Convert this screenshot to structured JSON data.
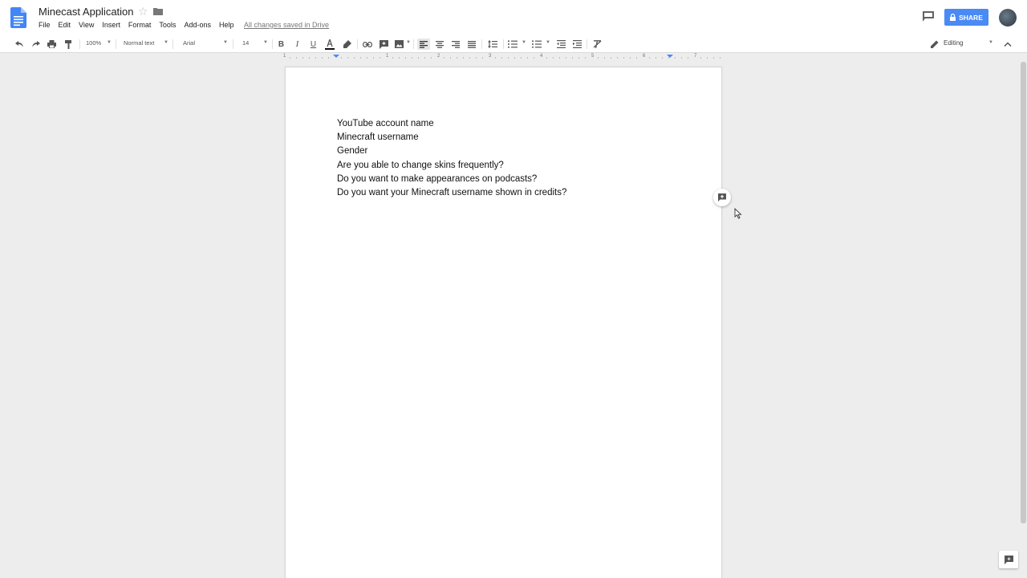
{
  "header": {
    "title": "Minecast Application",
    "menu": [
      "File",
      "Edit",
      "View",
      "Insert",
      "Format",
      "Tools",
      "Add-ons",
      "Help"
    ],
    "save_status": "All changes saved in Drive",
    "share_label": "SHARE"
  },
  "toolbar": {
    "zoom": "100%",
    "style": "Normal text",
    "font": "Arial",
    "font_size": "14",
    "mode": "Editing"
  },
  "ruler": {
    "labels": [
      "1",
      "1",
      "2",
      "3",
      "4",
      "5",
      "6",
      "7"
    ]
  },
  "document": {
    "lines": [
      "YouTube account name",
      "Minecraft username",
      "Gender",
      "Are you able to change skins frequently?",
      "Do you want to make appearances on podcasts?",
      "Do you want your Minecraft username shown in credits?"
    ]
  },
  "colors": {
    "share_button": "#4a8af4",
    "docs_blue": "#4285f4",
    "background": "#ededed"
  },
  "icons": [
    "docs-logo-icon",
    "star-icon",
    "folder-icon",
    "comments-icon",
    "lock-icon",
    "undo-icon",
    "redo-icon",
    "print-icon",
    "paint-format-icon",
    "bold-icon",
    "italic-icon",
    "underline-icon",
    "text-color-icon",
    "highlight-icon",
    "link-icon",
    "insert-comment-icon",
    "image-icon",
    "align-left-icon",
    "align-center-icon",
    "align-right-icon",
    "justify-icon",
    "line-spacing-icon",
    "numbered-list-icon",
    "bulleted-list-icon",
    "decrease-indent-icon",
    "increase-indent-icon",
    "clear-formatting-icon",
    "pencil-icon",
    "collapse-icon",
    "add-comment-icon",
    "explore-icon"
  ]
}
